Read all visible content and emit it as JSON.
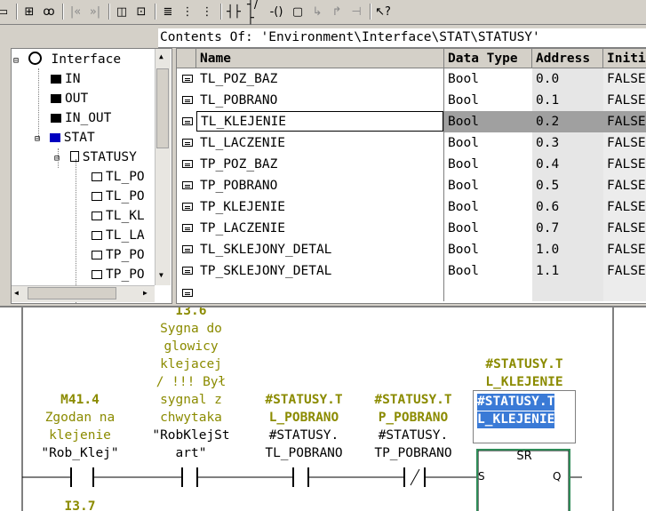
{
  "contents_path": "Contents Of: 'Environment\\Interface\\STAT\\STATUSY'",
  "tree": {
    "root": "Interface",
    "items": [
      "IN",
      "OUT",
      "IN_OUT",
      "STAT"
    ],
    "statusy": "STATUSY",
    "children": [
      "TL_PO",
      "TL_PO",
      "TL_KL",
      "TL_LA",
      "TP_PO",
      "TP_PO"
    ]
  },
  "table": {
    "headers": [
      "Name",
      "Data Type",
      "Address",
      "Initi"
    ],
    "rows": [
      {
        "name": "TL_POZ_BAZ",
        "type": "Bool",
        "address": "0.0",
        "initial": "FALSE"
      },
      {
        "name": "TL_POBRANO",
        "type": "Bool",
        "address": "0.1",
        "initial": "FALSE"
      },
      {
        "name": "TL_KLEJENIE",
        "type": "Bool",
        "address": "0.2",
        "initial": "FALSE"
      },
      {
        "name": "TL_LACZENIE",
        "type": "Bool",
        "address": "0.3",
        "initial": "FALSE"
      },
      {
        "name": "TP_POZ_BAZ",
        "type": "Bool",
        "address": "0.4",
        "initial": "FALSE"
      },
      {
        "name": "TP_POBRANO",
        "type": "Bool",
        "address": "0.5",
        "initial": "FALSE"
      },
      {
        "name": "TP_KLEJENIE",
        "type": "Bool",
        "address": "0.6",
        "initial": "FALSE"
      },
      {
        "name": "TP_LACZENIE",
        "type": "Bool",
        "address": "0.7",
        "initial": "FALSE"
      },
      {
        "name": "TL_SKLEJONY_DETAL",
        "type": "Bool",
        "address": "1.0",
        "initial": "FALSE"
      },
      {
        "name": "TP_SKLEJONY_DETAL",
        "type": "Bool",
        "address": "1.1",
        "initial": "FALSE"
      }
    ]
  },
  "ladder": {
    "c1": {
      "addr": "M41.4",
      "comment1": "Zgodan na",
      "comment2": "klejenie",
      "symbol": "\"Rob_Klej\""
    },
    "c2": {
      "addr": "I3.6",
      "comment": [
        "Sygna do",
        "glowicy",
        "klejacej",
        "/ !!! Był",
        "sygnal z",
        "chwytaka"
      ],
      "symbol1": "\"RobKlejSt",
      "symbol2": "art\""
    },
    "c3": {
      "top1": "#STATUSY.T",
      "top2": "L_POBRANO",
      "bottom1": "#STATUSY.",
      "bottom2": "TL_POBRANO"
    },
    "c4": {
      "top1": "#STATUSY.T",
      "top2": "P_POBRANO",
      "bottom1": "#STATUSY.",
      "bottom2": "TP_POBRANO"
    },
    "sr": {
      "top1": "#STATUSY.T",
      "top2": "L_KLEJENIE",
      "edit1": "#STATUSY.T",
      "edit2": "L_KLEJENIE",
      "label": "SR",
      "s": "S",
      "q": "Q"
    },
    "next": "I3.7"
  }
}
